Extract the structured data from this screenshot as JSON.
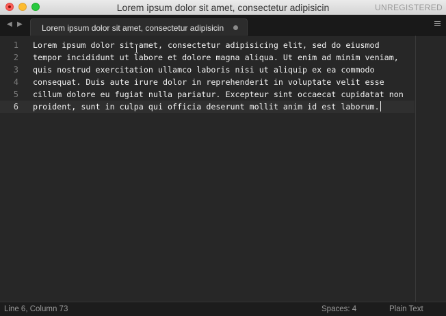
{
  "window": {
    "title": "Lorem ipsum dolor sit amet, consectetur adipisicin",
    "license_status": "UNREGISTERED"
  },
  "tabs": [
    {
      "label": "Lorem ipsum dolor sit amet, consectetur adipisicin",
      "dirty": true,
      "active": true
    }
  ],
  "nav": {
    "back_icon": "triangle-left",
    "forward_icon": "triangle-right",
    "menu_icon": "hamburger"
  },
  "editor": {
    "active_line": 6,
    "lines": [
      {
        "number": "1",
        "text": "Lorem ipsum dolor sit amet, consectetur adipisicing elit, sed do eiusmod"
      },
      {
        "number": "2",
        "text": "tempor incididunt ut labore et dolore magna aliqua. Ut enim ad minim veniam,"
      },
      {
        "number": "3",
        "text": "quis nostrud exercitation ullamco laboris nisi ut aliquip ex ea commodo"
      },
      {
        "number": "4",
        "text": "consequat. Duis aute irure dolor in reprehenderit in voluptate velit esse"
      },
      {
        "number": "5",
        "text": "cillum dolore eu fugiat nulla pariatur. Excepteur sint occaecat cupidatat non"
      },
      {
        "number": "6",
        "text": "proident, sunt in culpa qui officia deserunt mollit anim id est laborum."
      }
    ]
  },
  "statusbar": {
    "position": "Line 6, Column 73",
    "indentation": "Spaces: 4",
    "syntax": "Plain Text"
  },
  "colors": {
    "background": "#272727",
    "text": "#f2f2f2",
    "gutter_text": "#7c7c7c",
    "titlebar": "#dcdcdc",
    "close": "#fc5f57",
    "minimize": "#fdbc2e",
    "maximize": "#28c940"
  }
}
